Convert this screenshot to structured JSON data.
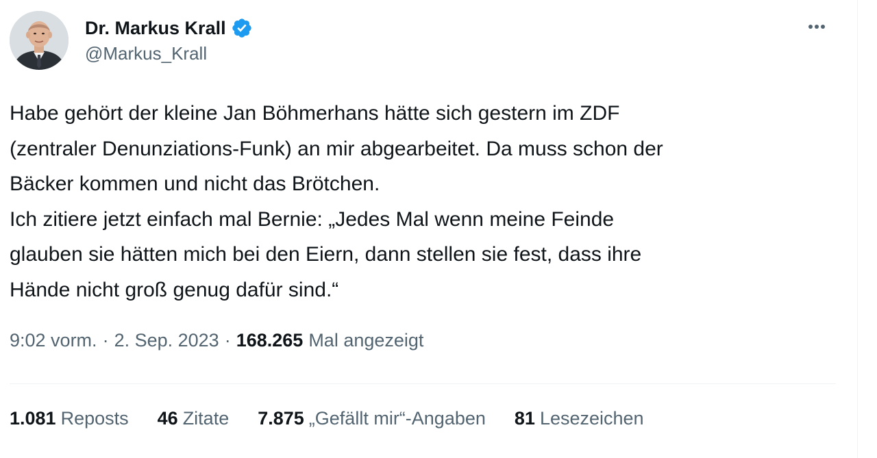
{
  "author": {
    "display_name": "Dr. Markus Krall",
    "handle": "@Markus_Krall",
    "verified_icon": "verified-badge-icon",
    "verified_color": "#1d9bf0"
  },
  "menu": {
    "more_icon": "more-options-icon"
  },
  "tweet": {
    "lines": [
      "Habe gehört der kleine Jan Böhmerhans hätte sich gestern im ZDF",
      "(zentraler Denunziations-Funk) an mir abgearbeitet. Da muss schon der",
      "Bäcker kommen und nicht das Brötchen.",
      "Ich zitiere jetzt einfach mal Bernie: „Jedes Mal wenn meine Feinde",
      "glauben sie hätten mich bei den Eiern, dann stellen sie fest, dass ihre",
      "Hände nicht groß genug dafür sind.“"
    ]
  },
  "meta": {
    "time": "9:02 vorm.",
    "separator": "·",
    "date": "2. Sep. 2023",
    "views_count": "168.265",
    "views_label": "Mal angezeigt"
  },
  "stats": {
    "reposts": {
      "count": "1.081",
      "label": "Reposts"
    },
    "quotes": {
      "count": "46",
      "label": "Zitate"
    },
    "likes": {
      "count": "7.875",
      "label": "„Gefällt mir“-Angaben"
    },
    "bookmarks": {
      "count": "81",
      "label": "Lesezeichen"
    }
  },
  "colors": {
    "text_primary": "#0f1419",
    "text_secondary": "#536471",
    "divider": "#eff3f4"
  }
}
